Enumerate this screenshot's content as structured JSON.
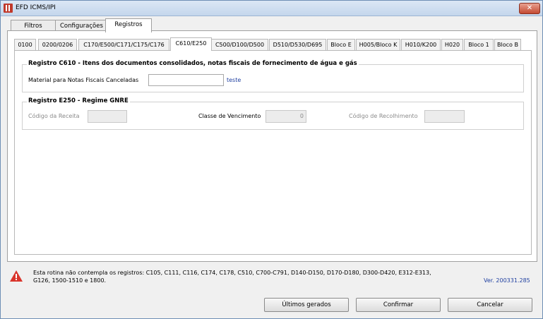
{
  "window": {
    "title": "EFD ICMS/IPI",
    "close_label": "✕"
  },
  "tabs": [
    {
      "label": "Filtros"
    },
    {
      "label": "Configurações"
    },
    {
      "label": "Registros"
    }
  ],
  "subtabs": [
    {
      "label": "0100"
    },
    {
      "label": "0200/0206"
    },
    {
      "label": "C170/E500/C171/C175/C176"
    },
    {
      "label": "C610/E250"
    },
    {
      "label": "C500/D100/D500"
    },
    {
      "label": "D510/D530/D695"
    },
    {
      "label": "Bloco E"
    },
    {
      "label": "H005/Bloco K"
    },
    {
      "label": "H010/K200"
    },
    {
      "label": "H020"
    },
    {
      "label": "Bloco 1"
    },
    {
      "label": "Bloco B"
    }
  ],
  "c610": {
    "title": "Registro C610 - Itens dos documentos consolidados, notas fiscais de fornecimento de água e gás",
    "material_label": "Material para Notas Fiscais Canceladas",
    "material_value": "",
    "link_text": "teste"
  },
  "e250": {
    "title": "Registro E250 - Regime GNRE",
    "codigo_receita_label": "Código da Receita",
    "codigo_receita_value": "",
    "classe_label": "Classe de Vencimento",
    "classe_value": "0",
    "codigo_recolhimento_label": "Código de Recolhimento",
    "codigo_recolhimento_value": ""
  },
  "footer": {
    "warning_line1": "Esta rotina não contempla os registros: C105, C111, C116, C174, C178, C510, C700-C791, D140-D150, D170-D180, D300-D420, E312-E313,",
    "warning_line2": "G126, 1500-1510 e 1800.",
    "version": "Ver. 200331.285",
    "btn_ultimos": "Últimos gerados",
    "btn_confirmar": "Confirmar",
    "btn_cancelar": "Cancelar"
  },
  "colors": {
    "accent_link": "#1f3fa0",
    "warning": "#d9342b"
  }
}
